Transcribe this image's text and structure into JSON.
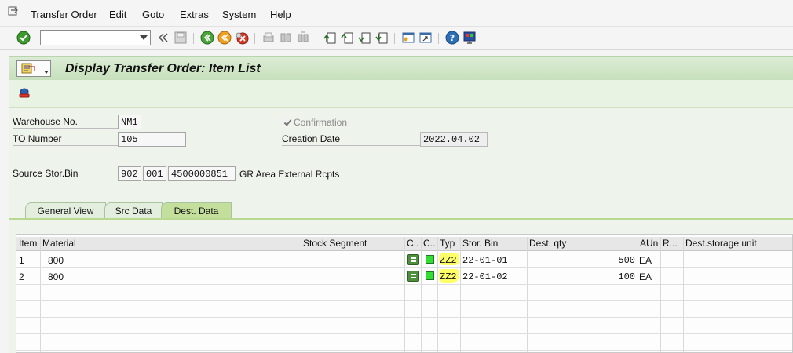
{
  "menu": {
    "items": [
      "Transfer Order",
      "Edit",
      "Goto",
      "Extras",
      "System",
      "Help"
    ]
  },
  "toolbar": {
    "command_value": ""
  },
  "title": "Display Transfer Order: Item List",
  "header": {
    "warehouse_label": "Warehouse No.",
    "warehouse_value": "NM1",
    "to_number_label": "TO Number",
    "to_number_value": "105",
    "confirmation_label": "Confirmation",
    "creation_date_label": "Creation Date",
    "creation_date_value": "2022.04.02",
    "source_bin_label": "Source Stor.Bin",
    "source_type": "902",
    "source_section": "001",
    "source_bin": "4500000851",
    "source_desc": "GR Area External Rcpts"
  },
  "tabs": [
    "General View",
    "Src Data",
    "Dest. Data"
  ],
  "table": {
    "columns": [
      "Item",
      "Material",
      "Stock Segment",
      "C..",
      "C..",
      "Typ",
      "Stor. Bin",
      "Dest. qty",
      "AUn",
      "R...",
      "Dest.storage unit"
    ],
    "rows": [
      {
        "item": "1",
        "material": "800",
        "typ": "ZZ2",
        "bin": "22-01-01",
        "qty": "500",
        "aun": "EA"
      },
      {
        "item": "2",
        "material": "800",
        "typ": "ZZ2",
        "bin": "22-01-02",
        "qty": "100",
        "aun": "EA"
      }
    ]
  },
  "colors": {
    "title_bg": "#c7e0bc",
    "tab_active": "#c4df9c",
    "highlight": "#ffff33"
  }
}
